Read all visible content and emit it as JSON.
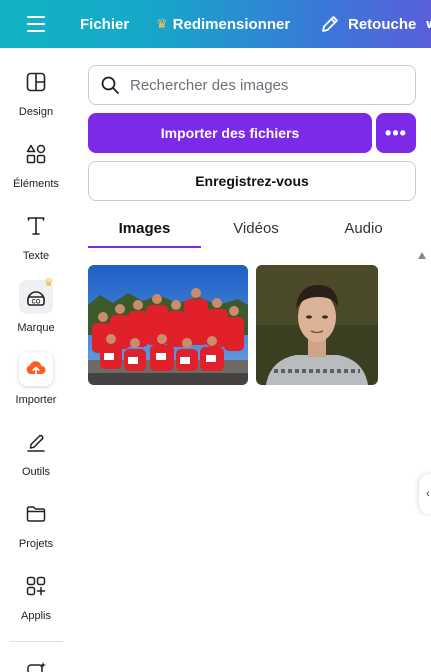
{
  "topbar": {
    "file_label": "Fichier",
    "resize_label": "Redimensionner",
    "retouch_label": "Retouche"
  },
  "sidebar": {
    "items": [
      {
        "label": "Design",
        "icon": "design-icon"
      },
      {
        "label": "Éléments",
        "icon": "elements-icon"
      },
      {
        "label": "Texte",
        "icon": "text-icon"
      },
      {
        "label": "Marque",
        "icon": "brand-icon"
      },
      {
        "label": "Importer",
        "icon": "upload-icon"
      },
      {
        "label": "Outils",
        "icon": "tools-icon"
      },
      {
        "label": "Projets",
        "icon": "folder-icon"
      },
      {
        "label": "Applis",
        "icon": "apps-icon"
      }
    ]
  },
  "panel": {
    "search_placeholder": "Rechercher des images",
    "import_button": "Importer des fichiers",
    "more_button": "•••",
    "register_button": "Enregistrez-vous",
    "tabs": [
      {
        "label": "Images",
        "active": true
      },
      {
        "label": "Vidéos",
        "active": false
      },
      {
        "label": "Audio",
        "active": false
      }
    ]
  },
  "colors": {
    "accent": "#7c2ae8",
    "topbar_start": "#12b3c4",
    "topbar_end": "#5a5fd9",
    "crown": "#f6c24b",
    "import_icon": "#ff5a1f"
  }
}
